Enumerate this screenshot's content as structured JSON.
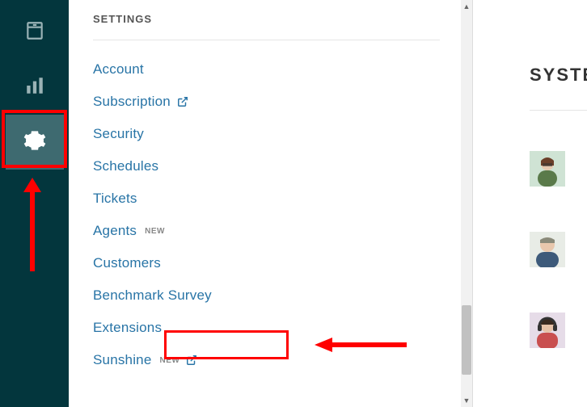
{
  "rail": {
    "items": [
      {
        "name": "archive-icon",
        "active": false
      },
      {
        "name": "stats-icon",
        "active": false
      },
      {
        "name": "gear-icon",
        "active": true
      }
    ]
  },
  "settings": {
    "heading": "SETTINGS",
    "nav": [
      {
        "label": "Account",
        "badge": null,
        "external": false
      },
      {
        "label": "Subscription",
        "badge": null,
        "external": true
      },
      {
        "label": "Security",
        "badge": null,
        "external": false
      },
      {
        "label": "Schedules",
        "badge": null,
        "external": false
      },
      {
        "label": "Tickets",
        "badge": null,
        "external": false
      },
      {
        "label": "Agents",
        "badge": "NEW",
        "external": false
      },
      {
        "label": "Customers",
        "badge": null,
        "external": false
      },
      {
        "label": "Benchmark Survey",
        "badge": null,
        "external": false
      },
      {
        "label": "Extensions",
        "badge": null,
        "external": false
      },
      {
        "label": "Sunshine",
        "badge": "NEW",
        "external": true
      }
    ]
  },
  "right": {
    "heading": "SYSTE"
  },
  "annotations": {
    "colors": {
      "highlight": "#ff0000",
      "link": "#2874a6",
      "rail_bg": "#03363d"
    }
  }
}
